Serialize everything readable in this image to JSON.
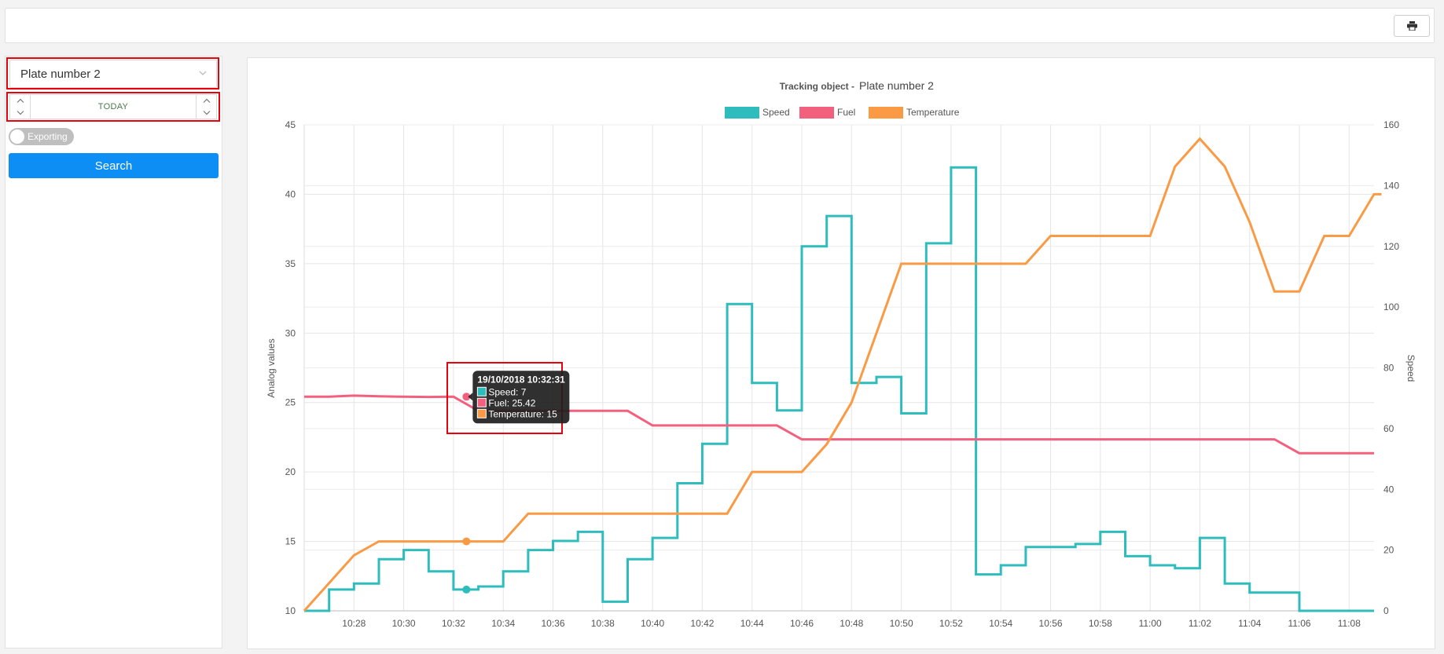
{
  "header": {
    "print_icon": "printer-icon"
  },
  "sidebar": {
    "vehicle_select": {
      "value": "Plate number 2",
      "icon": "chevron-down-icon"
    },
    "date_picker": {
      "value": "TODAY"
    },
    "export_toggle": {
      "label": "Exporting",
      "on": false
    },
    "search_label": "Search"
  },
  "colors": {
    "speed": "#2fbcbc",
    "fuel": "#f2607d",
    "temperature": "#fa9a45",
    "search": "#0c8ef5",
    "highlight": "#e8000b"
  },
  "chart_data": {
    "type": "line",
    "title_prefix": "Tracking object -",
    "title_object": "Plate number 2",
    "y_left_label": "Analog values",
    "y_right_label": "Speed",
    "y_left_range": [
      10,
      45
    ],
    "y_left_ticks": [
      "10",
      "15",
      "20",
      "25",
      "30",
      "35",
      "40",
      "45"
    ],
    "y_right_range": [
      0,
      160
    ],
    "y_right_ticks": [
      "0",
      "20",
      "40",
      "60",
      "80",
      "100",
      "120",
      "140",
      "160"
    ],
    "x_range": [
      626,
      669
    ],
    "x_ticks": [
      {
        "t": 628,
        "label": "10:28"
      },
      {
        "t": 630,
        "label": "10:30"
      },
      {
        "t": 632,
        "label": "10:32"
      },
      {
        "t": 634,
        "label": "10:34"
      },
      {
        "t": 636,
        "label": "10:36"
      },
      {
        "t": 638,
        "label": "10:38"
      },
      {
        "t": 640,
        "label": "10:40"
      },
      {
        "t": 642,
        "label": "10:42"
      },
      {
        "t": 644,
        "label": "10:44"
      },
      {
        "t": 646,
        "label": "10:46"
      },
      {
        "t": 648,
        "label": "10:48"
      },
      {
        "t": 650,
        "label": "10:50"
      },
      {
        "t": 652,
        "label": "10:52"
      },
      {
        "t": 654,
        "label": "10:54"
      },
      {
        "t": 656,
        "label": "10:56"
      },
      {
        "t": 658,
        "label": "10:58"
      },
      {
        "t": 660,
        "label": "11:00"
      },
      {
        "t": 662,
        "label": "11:02"
      },
      {
        "t": 664,
        "label": "11:04"
      },
      {
        "t": 666,
        "label": "11:06"
      },
      {
        "t": 668,
        "label": "11:08"
      }
    ],
    "legend": [
      {
        "name": "Speed",
        "color": "#2fbcbc"
      },
      {
        "name": "Fuel",
        "color": "#f2607d"
      },
      {
        "name": "Temperature",
        "color": "#fa9a45"
      }
    ],
    "series": [
      {
        "name": "Speed",
        "axis": "right",
        "stepped": true,
        "color": "#2fbcbc",
        "points": [
          [
            626,
            0
          ],
          [
            627,
            7
          ],
          [
            628,
            9
          ],
          [
            629,
            17
          ],
          [
            630,
            20
          ],
          [
            631,
            13
          ],
          [
            632,
            7
          ],
          [
            633,
            8
          ],
          [
            634,
            13
          ],
          [
            635,
            20
          ],
          [
            636,
            23
          ],
          [
            637,
            26
          ],
          [
            638,
            3
          ],
          [
            639,
            17
          ],
          [
            640,
            24
          ],
          [
            641,
            42
          ],
          [
            642,
            55
          ],
          [
            643,
            101
          ],
          [
            644,
            75
          ],
          [
            645,
            66
          ],
          [
            646,
            120
          ],
          [
            647,
            130
          ],
          [
            648,
            75
          ],
          [
            649,
            77
          ],
          [
            650,
            65
          ],
          [
            651,
            121
          ],
          [
            652,
            146
          ],
          [
            653,
            12
          ],
          [
            654,
            15
          ],
          [
            655,
            21
          ],
          [
            656,
            21
          ],
          [
            657,
            22
          ],
          [
            658,
            26
          ],
          [
            659,
            18
          ],
          [
            660,
            15
          ],
          [
            661,
            14
          ],
          [
            662,
            24
          ],
          [
            663,
            9
          ],
          [
            664,
            6
          ],
          [
            665,
            6
          ],
          [
            666,
            0
          ],
          [
            669,
            0
          ]
        ]
      },
      {
        "name": "Fuel",
        "axis": "left",
        "stepped": false,
        "color": "#f2607d",
        "points": [
          [
            626,
            25.42
          ],
          [
            627,
            25.42
          ],
          [
            628,
            25.5
          ],
          [
            629,
            25.45
          ],
          [
            630,
            25.42
          ],
          [
            631,
            25.4
          ],
          [
            632,
            25.42
          ],
          [
            633,
            24.4
          ],
          [
            634,
            24.4
          ],
          [
            635,
            24.4
          ],
          [
            636,
            24.4
          ],
          [
            637,
            24.4
          ],
          [
            638,
            24.4
          ],
          [
            639,
            24.4
          ],
          [
            640,
            23.35
          ],
          [
            641,
            23.35
          ],
          [
            642,
            23.35
          ],
          [
            643,
            23.35
          ],
          [
            644,
            23.35
          ],
          [
            645,
            23.35
          ],
          [
            646,
            22.35
          ],
          [
            647,
            22.35
          ],
          [
            648,
            22.35
          ],
          [
            649,
            22.35
          ],
          [
            650,
            22.35
          ],
          [
            651,
            22.35
          ],
          [
            652,
            22.35
          ],
          [
            653,
            22.35
          ],
          [
            654,
            22.35
          ],
          [
            655,
            22.35
          ],
          [
            656,
            22.35
          ],
          [
            657,
            22.35
          ],
          [
            658,
            22.35
          ],
          [
            659,
            22.35
          ],
          [
            660,
            22.35
          ],
          [
            661,
            22.35
          ],
          [
            662,
            22.35
          ],
          [
            663,
            22.35
          ],
          [
            664,
            22.35
          ],
          [
            665,
            22.35
          ],
          [
            666,
            21.35
          ],
          [
            667,
            21.35
          ],
          [
            668,
            21.35
          ],
          [
            669,
            21.35
          ]
        ]
      },
      {
        "name": "Temperature",
        "axis": "left",
        "stepped": false,
        "color": "#fa9a45",
        "points": [
          [
            626,
            10
          ],
          [
            627,
            12
          ],
          [
            628,
            14
          ],
          [
            629,
            15
          ],
          [
            630,
            15
          ],
          [
            631,
            15
          ],
          [
            632,
            15
          ],
          [
            633,
            15
          ],
          [
            634,
            15
          ],
          [
            635,
            17
          ],
          [
            636,
            17
          ],
          [
            637,
            17
          ],
          [
            638,
            17
          ],
          [
            639,
            17
          ],
          [
            640,
            17
          ],
          [
            641,
            17
          ],
          [
            642,
            17
          ],
          [
            643,
            17
          ],
          [
            644,
            20
          ],
          [
            645,
            20
          ],
          [
            646,
            20
          ],
          [
            647,
            22
          ],
          [
            648,
            25
          ],
          [
            649,
            30
          ],
          [
            650,
            35
          ],
          [
            651,
            35
          ],
          [
            652,
            35
          ],
          [
            653,
            35
          ],
          [
            654,
            35
          ],
          [
            655,
            35
          ],
          [
            656,
            37
          ],
          [
            657,
            37
          ],
          [
            658,
            37
          ],
          [
            659,
            37
          ],
          [
            660,
            37
          ],
          [
            661,
            42
          ],
          [
            662,
            44
          ],
          [
            663,
            42
          ],
          [
            664,
            38
          ],
          [
            665,
            33
          ],
          [
            666,
            33
          ],
          [
            667,
            37
          ],
          [
            668,
            37
          ],
          [
            669,
            40
          ],
          [
            669.3,
            40
          ]
        ]
      }
    ],
    "tooltip": {
      "t": 632.52,
      "title": "19/10/2018 10:32:31",
      "lines": [
        {
          "text": "Speed: 7",
          "color": "#2fbcbc",
          "series": "Speed",
          "value": 7
        },
        {
          "text": "Fuel: 25.42",
          "color": "#f2607d",
          "series": "Fuel",
          "value": 25.42
        },
        {
          "text": "Temperature: 15",
          "color": "#fa9a45",
          "series": "Temperature",
          "value": 15
        }
      ]
    }
  }
}
